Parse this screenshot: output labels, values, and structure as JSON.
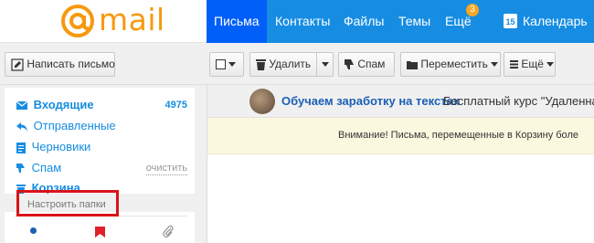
{
  "header": {
    "logo_text": "mail",
    "nav": [
      {
        "label": "Письма"
      },
      {
        "label": "Контакты"
      },
      {
        "label": "Файлы"
      },
      {
        "label": "Темы"
      },
      {
        "label": "Ещё"
      }
    ],
    "badge_count": "3",
    "calendar_day": "15",
    "calendar_label": "Календарь",
    "colors": {
      "bar": "#168de2",
      "active": "#005ff9",
      "logo": "#f6990e"
    }
  },
  "toolbar": {
    "compose_label": "Написать письмо",
    "delete_label": "Удалить",
    "spam_label": "Спам",
    "move_label": "Переместить",
    "more_label": "Ещё"
  },
  "sidebar": {
    "folders": [
      {
        "label": "Входящие",
        "icon": "envelope-icon",
        "count": "4975"
      },
      {
        "label": "Отправленные",
        "icon": "sent-arrow-icon"
      },
      {
        "label": "Черновики",
        "icon": "draft-icon"
      },
      {
        "label": "Спам",
        "icon": "thumb-down-icon",
        "action": "очистить"
      },
      {
        "label": "Корзина",
        "icon": "trash-icon"
      }
    ],
    "settings_label": "Настроить папки"
  },
  "main": {
    "promo_sender": "Обучаем заработку на текстах",
    "promo_snippet": "Бесплатный курс \"Удаленная п",
    "notice": "Внимание! Письма, перемещенные в Корзину боле"
  }
}
